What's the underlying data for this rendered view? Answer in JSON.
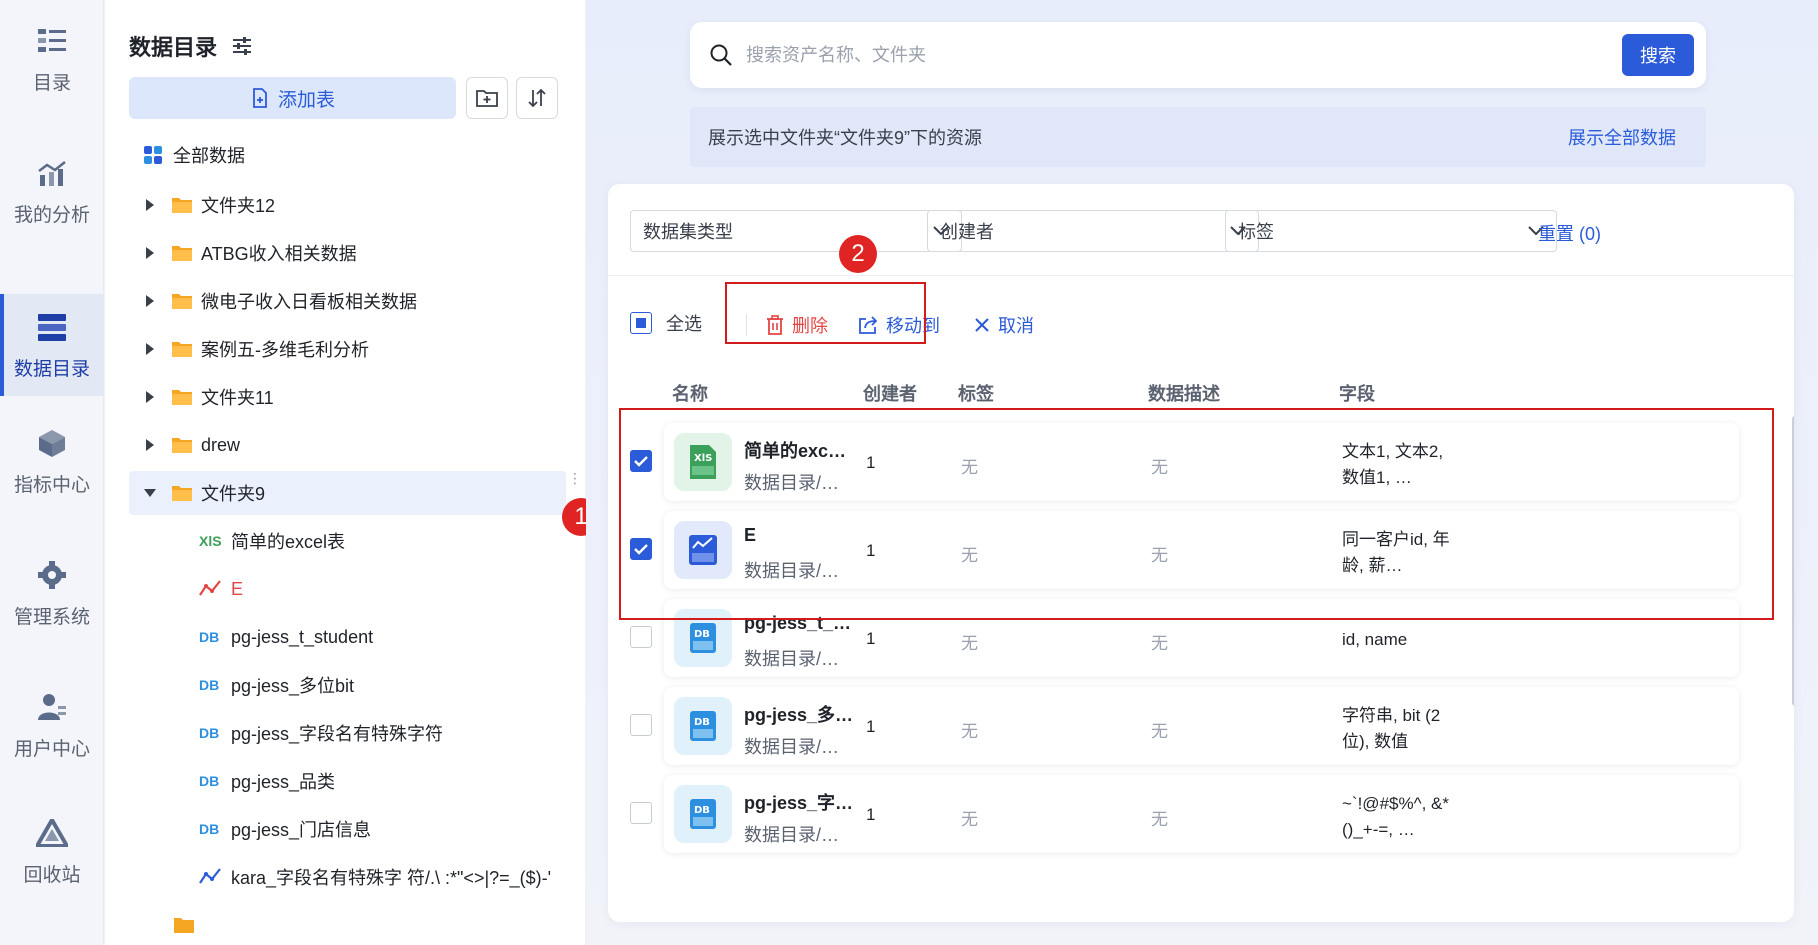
{
  "rail": {
    "items": [
      {
        "label": "目录",
        "icon": "catalog-icon"
      },
      {
        "label": "我的分析",
        "icon": "analysis-icon"
      },
      {
        "label": "数据目录",
        "icon": "data-catalog-icon",
        "active": true
      },
      {
        "label": "指标中心",
        "icon": "metric-cube-icon"
      },
      {
        "label": "管理系统",
        "icon": "gear-icon"
      },
      {
        "label": "用户中心",
        "icon": "user-icon"
      },
      {
        "label": "回收站",
        "icon": "recycle-icon"
      }
    ]
  },
  "tree": {
    "title": "数据目录",
    "add_table_label": "添加表",
    "all_data_label": "全部数据",
    "folders": [
      {
        "label": "文件夹12"
      },
      {
        "label": "ATBG收入相关数据"
      },
      {
        "label": "微电子收入日看板相关数据"
      },
      {
        "label": "案例五-多维毛利分析"
      },
      {
        "label": "文件夹11"
      },
      {
        "label": "drew"
      },
      {
        "label": "文件夹9",
        "expanded": true
      }
    ],
    "children": [
      {
        "type_icon": "XlS",
        "icon_color": "#3aa05a",
        "label": "简单的excel表",
        "label_color": "#1f2329"
      },
      {
        "type_icon": "chart",
        "icon_color": "#e54545",
        "label": "E",
        "label_color": "#e54545"
      },
      {
        "type_icon": "DB",
        "icon_color": "#2c8fe0",
        "label": "pg-jess_t_student",
        "label_color": "#1f2329"
      },
      {
        "type_icon": "DB",
        "icon_color": "#2c8fe0",
        "label": "pg-jess_多位bit",
        "label_color": "#1f2329"
      },
      {
        "type_icon": "DB",
        "icon_color": "#2c8fe0",
        "label": "pg-jess_字段名有特殊字符",
        "label_color": "#1f2329"
      },
      {
        "type_icon": "DB",
        "icon_color": "#2c8fe0",
        "label": "pg-jess_品类",
        "label_color": "#1f2329"
      },
      {
        "type_icon": "DB",
        "icon_color": "#2c8fe0",
        "label": "pg-jess_门店信息",
        "label_color": "#1f2329"
      },
      {
        "type_icon": "chart",
        "icon_color": "#2c5bd9",
        "label": "kara_字段名有特殊字 符/.\\ :*\"<>|?=_($)-'",
        "label_color": "#1f2329"
      }
    ]
  },
  "search": {
    "placeholder": "搜索资产名称、文件夹",
    "button_label": "搜索"
  },
  "notice": {
    "text": "展示选中文件夹“文件夹9”下的资源",
    "show_all_label": "展示全部数据"
  },
  "filters": {
    "dataset_type": "数据集类型",
    "creator": "创建者",
    "tag": "标签",
    "reset_label": "重置 (0)"
  },
  "toolbar": {
    "select_all_label": "全选",
    "delete_label": "删除",
    "move_label": "移动到",
    "cancel_label": "取消"
  },
  "table": {
    "headers": {
      "name": "名称",
      "creator": "创建者",
      "tag": "标签",
      "desc": "数据描述",
      "fields": "字段"
    },
    "rows": [
      {
        "icon": "excel-file-icon",
        "name": "简单的excel表",
        "path": "数据目录/文…",
        "creator": "1",
        "tag": "无",
        "desc": "无",
        "fields": "文本1, 文本2, 数值1, …",
        "checked": true
      },
      {
        "icon": "chart-dataset-icon",
        "name": "E",
        "path": "数据目录/文…",
        "creator": "1",
        "tag": "无",
        "desc": "无",
        "fields": "同一客户id, 年龄, 薪…",
        "checked": true
      },
      {
        "icon": "db-table-icon",
        "name": "pg-jess_t_st…",
        "path": "数据目录/文…",
        "creator": "1",
        "tag": "无",
        "desc": "无",
        "fields": "id, name",
        "checked": false
      },
      {
        "icon": "db-table-icon",
        "name": "pg-jess_多位…",
        "path": "数据目录/文…",
        "creator": "1",
        "tag": "无",
        "desc": "无",
        "fields": "字符串, bit (2位), 数值",
        "checked": false
      },
      {
        "icon": "db-table-icon",
        "name": "pg-jess_字段…",
        "path": "数据目录/文…",
        "creator": "1",
        "tag": "无",
        "desc": "无",
        "fields": "~`!@#$%^, &*()_+-=, …",
        "checked": false
      }
    ]
  },
  "annotations": {
    "badge1": "1",
    "badge2": "2"
  },
  "colors": {
    "accent": "#2c5bd9",
    "danger": "#e54545",
    "highlight_box": "#d41b1b"
  }
}
